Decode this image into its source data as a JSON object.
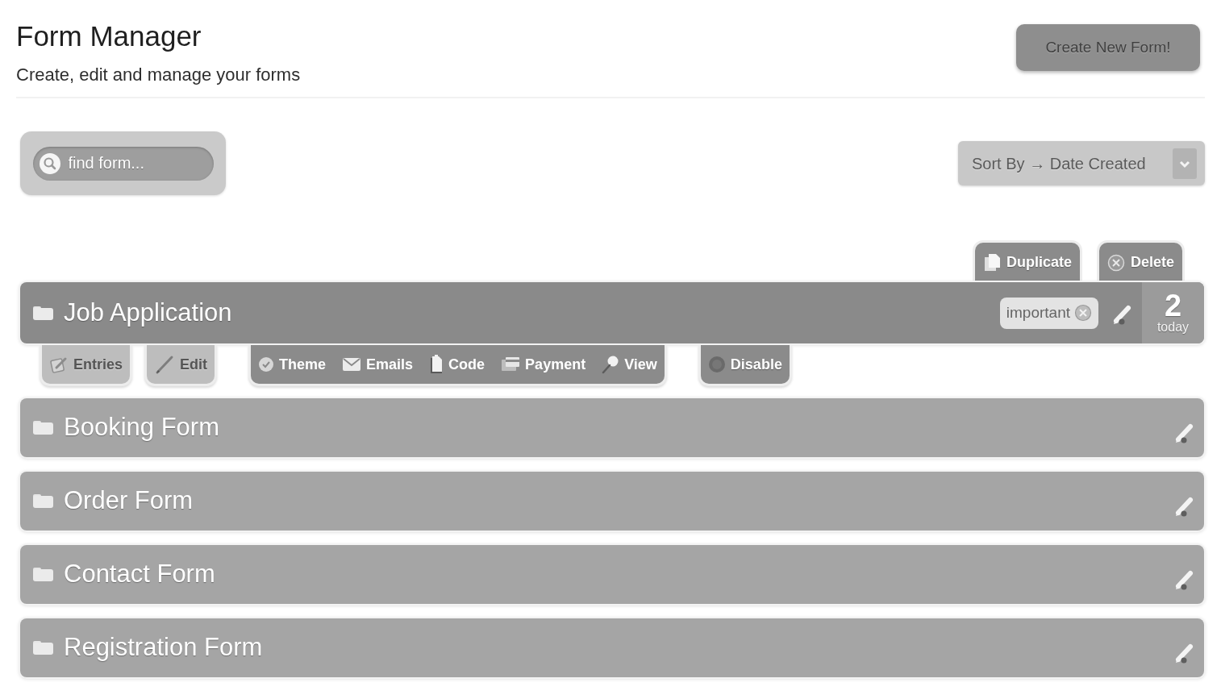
{
  "header": {
    "title": "Form Manager",
    "subtitle": "Create, edit and manage your forms",
    "create_button": "Create New Form!"
  },
  "search": {
    "placeholder": "find form..."
  },
  "sort": {
    "label": "Sort By → Date Created"
  },
  "forms": [
    {
      "name": "Job Application",
      "expanded": true,
      "row_actions": [
        {
          "kind": "duplicate",
          "label": "Duplicate"
        },
        {
          "kind": "delete",
          "label": "Delete"
        }
      ],
      "tags": [
        {
          "label": "important"
        }
      ],
      "count": "2",
      "count_label": "today",
      "action_groups": [
        {
          "kind": "light",
          "items": [
            {
              "kind": "entries",
              "label": "Entries"
            }
          ]
        },
        {
          "kind": "light",
          "items": [
            {
              "kind": "edit",
              "label": "Edit"
            }
          ]
        },
        {
          "kind": "dark",
          "items": [
            {
              "kind": "theme",
              "label": "Theme"
            },
            {
              "kind": "emails",
              "label": "Emails"
            },
            {
              "kind": "code",
              "label": "Code"
            },
            {
              "kind": "payment",
              "label": "Payment"
            },
            {
              "kind": "view",
              "label": "View"
            }
          ]
        },
        {
          "kind": "dark",
          "items": [
            {
              "kind": "disable",
              "label": "Disable"
            }
          ]
        }
      ]
    },
    {
      "name": "Booking Form",
      "expanded": false
    },
    {
      "name": "Order Form",
      "expanded": false
    },
    {
      "name": "Contact Form",
      "expanded": false
    },
    {
      "name": "Registration Form",
      "expanded": false
    }
  ]
}
